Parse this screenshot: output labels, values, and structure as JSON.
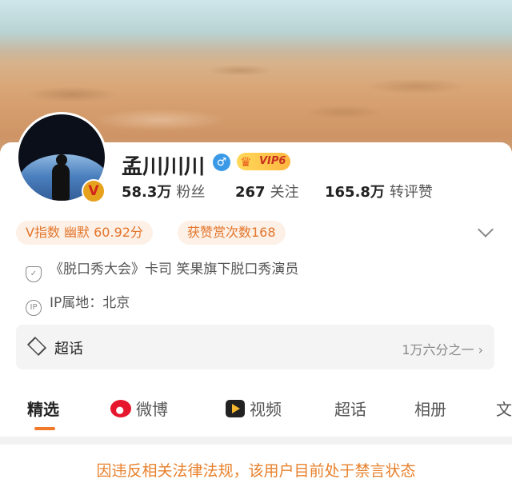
{
  "profile": {
    "name": "孟川川川",
    "gender_symbol": "♂",
    "vip_label": "VIP6",
    "verified_letter": "V"
  },
  "stats": [
    {
      "value": "58.3万",
      "label": "粉丝"
    },
    {
      "value": "267",
      "label": "关注"
    },
    {
      "value": "165.8万",
      "label": "转评赞"
    }
  ],
  "tags": [
    "V指数 幽默 60.92分",
    "获赞赏次数168"
  ],
  "info": {
    "description": "《脱口秀大会》卡司  笑果旗下脱口秀演员",
    "ip_location": "IP属地：北京",
    "ip_icon_text": "IP"
  },
  "chaohua": {
    "label": "超话",
    "rank": "1万六分之一 ›"
  },
  "tabs": [
    "精选",
    "微博",
    "视频",
    "超话",
    "相册",
    "文"
  ],
  "notice": "因违反相关法律法规，该用户目前处于禁言状态",
  "colors": {
    "accent": "#f07a2a",
    "tag_bg": "#fdf0e6",
    "tag_text": "#e3762c",
    "notice_text": "#e8812d"
  }
}
